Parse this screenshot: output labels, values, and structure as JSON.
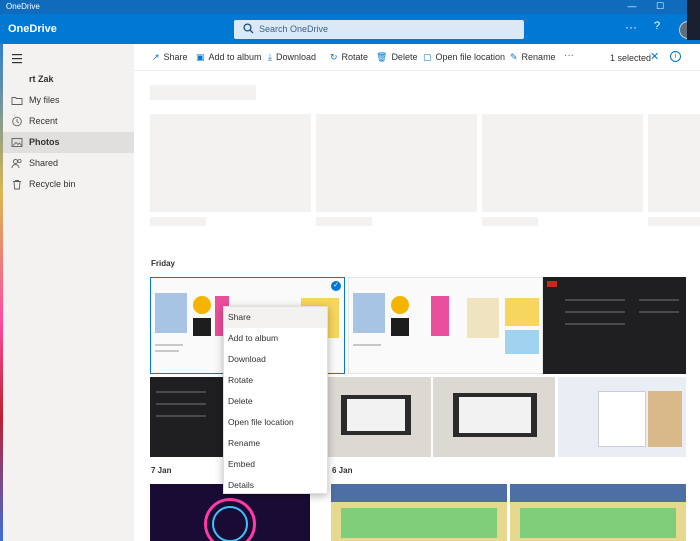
{
  "window": {
    "title": "OneDrive",
    "min": "—",
    "max": "☐",
    "close": "✕"
  },
  "appbar": {
    "brand": "OneDrive",
    "search_placeholder": "Search OneDrive",
    "more": "···",
    "help": "?"
  },
  "sidebar": {
    "user": "rt Zak",
    "items": [
      {
        "label": "My files",
        "icon": "folder-icon"
      },
      {
        "label": "Recent",
        "icon": "clock-icon"
      },
      {
        "label": "Photos",
        "icon": "image-icon"
      },
      {
        "label": "Shared",
        "icon": "people-icon"
      },
      {
        "label": "Recycle bin",
        "icon": "trash-icon"
      }
    ]
  },
  "commands": [
    "Share",
    "Add to album",
    "Download",
    "Rotate",
    "Delete",
    "Open file location",
    "Rename"
  ],
  "command_more": "···",
  "selection": {
    "count_label": "1 selected",
    "clear": "✕",
    "info": "i"
  },
  "groups": [
    "Friday",
    "7 Jan",
    "6 Jan"
  ],
  "context_menu": [
    "Share",
    "Add to album",
    "Download",
    "Rotate",
    "Delete",
    "Open file location",
    "Rename",
    "Embed",
    "Details"
  ],
  "colors": {
    "brand": "#0078d4",
    "sidebar": "#f3f2f1",
    "selected": "#e1dfdd"
  }
}
